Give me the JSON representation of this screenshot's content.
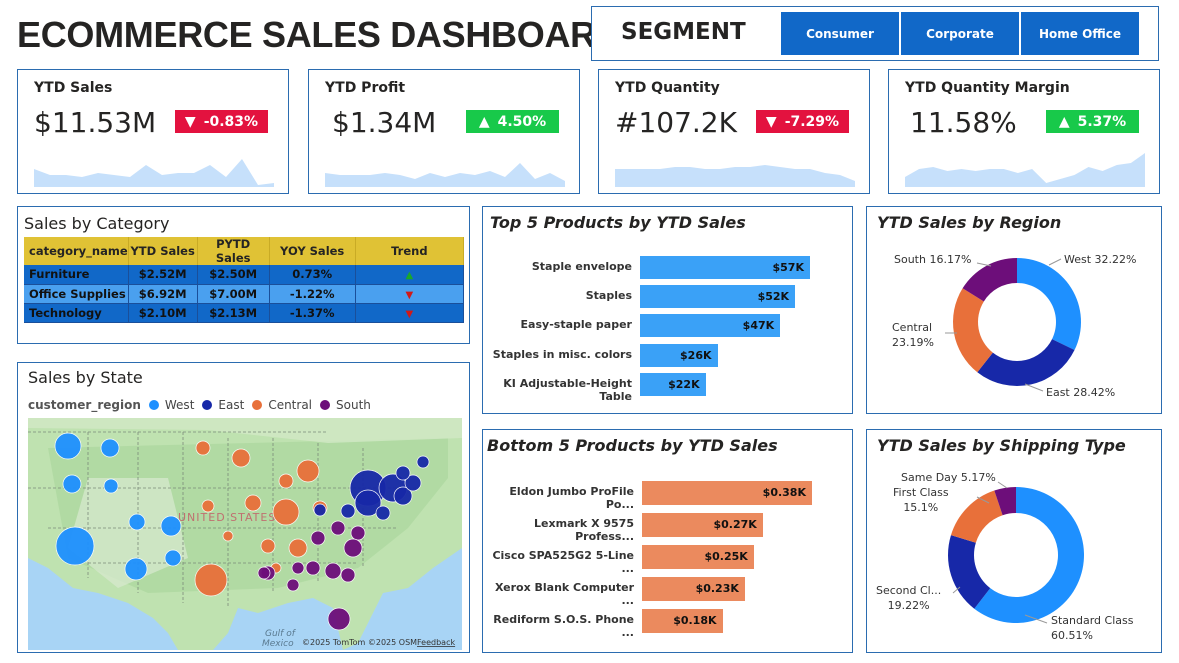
{
  "header": {
    "title": "ECOMMERCE SALES DASHBOARD"
  },
  "segment": {
    "label": "SEGMENT",
    "options": [
      "Consumer",
      "Corporate",
      "Home Office"
    ]
  },
  "colors": {
    "accent": "#1168c8",
    "border": "#2b6cb0",
    "down": "#e3123f",
    "up": "#18c94a",
    "spark": "#c6e0fb",
    "west": "#1e90ff",
    "east": "#1728a8",
    "central": "#e8703a",
    "south": "#6d0e7a",
    "top_bar": "#3aa1f7",
    "bottom_bar": "#eb8a5e",
    "table_header": "#e0c235"
  },
  "kpis": [
    {
      "label": "YTD Sales",
      "value": "$11.53M",
      "change": "-0.83%",
      "direction": "down",
      "trend": [
        0.45,
        0.3,
        0.3,
        0.25,
        0.35,
        0.3,
        0.25,
        0.55,
        0.3,
        0.35,
        0.35,
        0.55,
        0.25,
        0.7,
        0.05,
        0.1
      ]
    },
    {
      "label": "YTD Profit",
      "value": "$1.34M",
      "change": "4.50%",
      "direction": "up",
      "trend": [
        0.35,
        0.3,
        0.3,
        0.3,
        0.35,
        0.3,
        0.2,
        0.35,
        0.25,
        0.35,
        0.3,
        0.4,
        0.25,
        0.6,
        0.2,
        0.35,
        0.15
      ]
    },
    {
      "label": "YTD Quantity",
      "value": "#107.2K",
      "change": "-7.29%",
      "direction": "down",
      "trend": [
        0.45,
        0.45,
        0.45,
        0.45,
        0.5,
        0.5,
        0.45,
        0.45,
        0.5,
        0.5,
        0.55,
        0.5,
        0.45,
        0.45,
        0.35,
        0.3,
        0.15
      ]
    },
    {
      "label": "YTD Quantity Margin",
      "value": "11.58%",
      "change": "5.37%",
      "direction": "up",
      "trend": [
        0.25,
        0.45,
        0.5,
        0.4,
        0.45,
        0.4,
        0.45,
        0.45,
        0.35,
        0.45,
        0.1,
        0.2,
        0.3,
        0.5,
        0.4,
        0.55,
        0.6,
        0.85
      ]
    }
  ],
  "category": {
    "title": "Sales by Category",
    "headers": [
      "category_name",
      "YTD Sales",
      "PYTD Sales",
      "YOY Sales",
      "Trend"
    ],
    "rows": [
      {
        "name": "Furniture",
        "ytd": "$2.52M",
        "pytd": "$2.50M",
        "yoy": "0.73%",
        "trend": "up"
      },
      {
        "name": "Office Supplies",
        "ytd": "$6.92M",
        "pytd": "$7.00M",
        "yoy": "-1.22%",
        "trend": "down"
      },
      {
        "name": "Technology",
        "ytd": "$2.10M",
        "pytd": "$2.13M",
        "yoy": "-1.37%",
        "trend": "down"
      }
    ]
  },
  "map": {
    "title": "Sales by State",
    "legend_title": "customer_region",
    "legend": [
      "West",
      "East",
      "Central",
      "South"
    ],
    "country_label": "UNITED STATES",
    "gulf_label": [
      "Gulf of",
      "Mexico"
    ],
    "attribution": "©2025 TomTom  ©2025 OSM",
    "feedback": "Feedback"
  },
  "chart_data": [
    {
      "type": "bar",
      "title": "Top 5 Products by YTD Sales",
      "categories": [
        "Staple envelope",
        "Staples",
        "Easy-staple paper",
        "Staples in misc. colors",
        "KI Adjustable-Height Table"
      ],
      "values": [
        57,
        52,
        47,
        26,
        22
      ],
      "value_labels": [
        "$57K",
        "$52K",
        "$47K",
        "$26K",
        "$22K"
      ],
      "orientation": "horizontal"
    },
    {
      "type": "bar",
      "title": "Bottom 5 Products by YTD Sales",
      "categories": [
        "Eldon Jumbo ProFile Po...",
        "Lexmark X 9575 Profess...",
        "Cisco SPA525G2 5-Line ...",
        "Xerox Blank Computer ...",
        "Rediform S.O.S. Phone ..."
      ],
      "values": [
        0.38,
        0.27,
        0.25,
        0.23,
        0.18
      ],
      "value_labels": [
        "$0.38K",
        "$0.27K",
        "$0.25K",
        "$0.23K",
        "$0.18K"
      ],
      "orientation": "horizontal"
    },
    {
      "type": "pie",
      "title": "YTD Sales by Region",
      "donut": true,
      "slices": [
        {
          "label": "West",
          "value": 32.22,
          "display": "West 32.22%"
        },
        {
          "label": "East",
          "value": 28.42,
          "display": "East 28.42%"
        },
        {
          "label": "Central",
          "value": 23.19,
          "display": [
            "Central",
            "23.19%"
          ]
        },
        {
          "label": "South",
          "value": 16.17,
          "display": "South 16.17%"
        }
      ]
    },
    {
      "type": "pie",
      "title": "YTD Sales by Shipping Type",
      "donut": true,
      "slices": [
        {
          "label": "Standard Class",
          "value": 60.51,
          "display": [
            "Standard Class",
            "60.51%"
          ]
        },
        {
          "label": "Second Class",
          "value": 19.22,
          "display": [
            "Second Cl...",
            "19.22%"
          ]
        },
        {
          "label": "First Class",
          "value": 15.1,
          "display": [
            "First Class",
            "15.1%"
          ]
        },
        {
          "label": "Same Day",
          "value": 5.17,
          "display": "Same Day 5.17%"
        }
      ]
    }
  ]
}
